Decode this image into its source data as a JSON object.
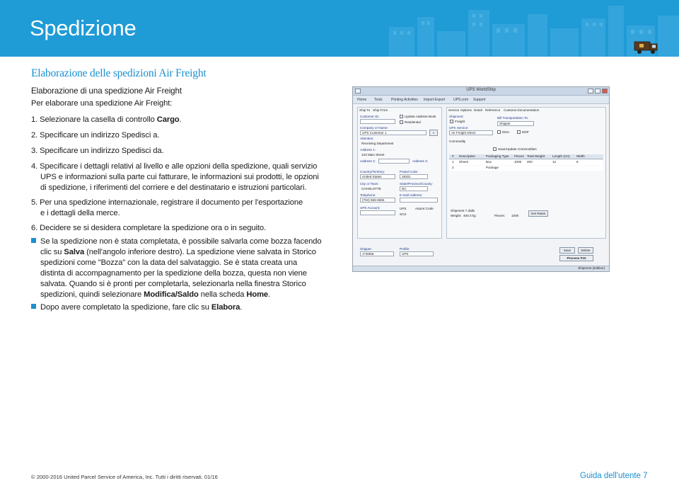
{
  "header": {
    "title": "Spedizione",
    "bg_color": "#1f9bd6"
  },
  "section": {
    "title": "Elaborazione delle spedizioni Air Freight",
    "subtitle": "Elaborazione di una spedizione Air Freight",
    "intro": "Per elaborare una spedizione Air Freight:"
  },
  "steps": {
    "s1_num": "1.",
    "s1_text": "Selezionare la casella di controllo",
    "s1_bold": "Cargo",
    "s1_end": ".",
    "s2_num": "2.",
    "s2_text": "Specificare un indirizzo Spedisci a.",
    "s3_num": "3.",
    "s3_text": "Specificare un indirizzo Spedisci da.",
    "s4_num": "4.",
    "s4_line1": "Specificare i dettagli relativi al livello e alle opzioni della spedizione, quali servizio",
    "s4_line2": "UPS e informazioni sulla parte cui fatturare, le informazioni sui prodotti, le opzioni",
    "s4_line3": "di spedizione, i riferimenti del corriere e del destinatario e istruzioni particolari.",
    "s5_num": "5.",
    "s5_line1": "Per una spedizione internazionale, registrare il documento per l'esportazione",
    "s5_line2": "e i dettagli della merce.",
    "s6_num": "6.",
    "s6_text": "Decidere se si desidera completare la spedizione ora o in seguito."
  },
  "bullets": {
    "b1_l1": "Se la spedizione non è stata completata, è possibile salvarla come bozza facendo",
    "b1_l2a": "clic su ",
    "b1_l2b": "Salva",
    "b1_l2c": " (nell'angolo inferiore destro). La spedizione viene salvata in Storico",
    "b1_l3": "spedizioni come \"Bozza\" con la data del salvataggio. Se è stata creata una",
    "b1_l4": "distinta di accompagnamento per la spedizione della bozza, questa non viene",
    "b1_l5": "salvata. Quando si è pronti per completarla, selezionarla nella finestra Storico",
    "b1_l6a": "spedizioni, quindi selezionare ",
    "b1_l6b": "Modifica/Saldo",
    "b1_l6c": " nella scheda ",
    "b1_l6d": "Home",
    "b1_l6e": ".",
    "b2a": "Dopo avere completato la spedizione, fare clic su ",
    "b2b": "Elabora",
    "b2c": "."
  },
  "screenshot": {
    "window_title": "UPS WorldShip",
    "menu": [
      "Home",
      "Tools",
      "Printing Activities",
      "Import-Export",
      "UPS.com",
      "Support"
    ],
    "tabs_left": [
      "Ship To",
      "Ship From"
    ],
    "tabs_right": [
      "Service",
      "Options",
      "Detail",
      "Reference",
      "Customs Documentation"
    ],
    "customer_id_label": "Customer ID:",
    "update_address_book": "Update Address Book",
    "residential": "Residential",
    "company_label": "Company or Name:",
    "company_value": "UPS Customer 1",
    "attention_label": "Attention:",
    "attention_value": "Receiving Department",
    "address1_label": "Address 1:",
    "address1_value": "123 Main Street",
    "address2_label": "Address 2:",
    "address3_label": "Address 3:",
    "country_label": "Country/Territory:",
    "country_value": "United States",
    "postal_label": "Postal Code:",
    "postal_value": "28201",
    "city_label": "City or Town:",
    "city_value": "CHARLOTTE",
    "state_label": "State/Province/County:",
    "state_value": "NC",
    "telephone_label": "Telephone:",
    "telephone_value": "(704) 555-5555",
    "email_label": "E-mail Address:",
    "ups_account_label": "UPS Account:",
    "airport_code": "Airport Code",
    "ups_option": "UPS",
    "scs_option": "SCS",
    "shipment_label": "Shipment:",
    "freight_label": "Freight",
    "bill_transport_label": "Bill Transportation To:",
    "bill_value": "Shipper",
    "ups_service_label": "UPS Service:",
    "service_value": "Air Freight Direct",
    "ddu": "DDU",
    "ddp": "DDP",
    "commodity_tab": "Commodity",
    "save_update": "Save/Update Commodities",
    "grid_headers": [
      "#",
      "Description",
      "Packaging Type",
      "Pieces",
      "Total Weight",
      "Length (cm)",
      "Width"
    ],
    "row1": [
      "1",
      "Shoes",
      "Box",
      "1000",
      "400",
      "12",
      "8"
    ],
    "row2": [
      "2",
      "",
      "Package",
      "",
      "",
      "",
      ""
    ],
    "shipment_totals": "Shipment 7 dalls",
    "weight_label": "Weight:",
    "weight_value": "400.0 kg",
    "pieces_label": "Pieces:",
    "pieces_value": "1000",
    "get_rates": "Get Rates",
    "shipper_label": "Shipper:",
    "shipper_value": "1YE866",
    "profile_label": "Profile:",
    "profile_value": "UPS",
    "save_btn": "Save",
    "delete_btn": "Delete",
    "process_btn": "Process F10",
    "status_bar": "Shipment (Edition)"
  },
  "footer": {
    "copyright": "© 2000-2016 United Parcel Service of America, Inc. Tutti i diritti riservati. 01/16",
    "guide": "Guida dell'utente  7"
  },
  "colors": {
    "accent": "#1a8fcf",
    "text": "#1a1a1a"
  }
}
